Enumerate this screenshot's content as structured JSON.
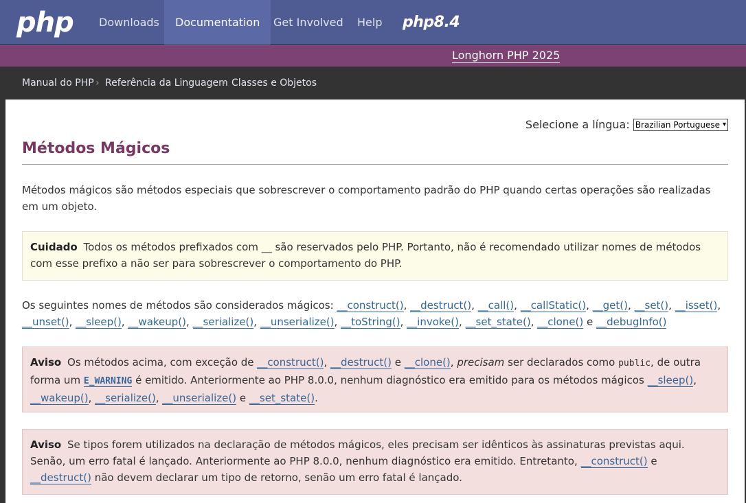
{
  "nav": {
    "logo": "php",
    "items": [
      "Downloads",
      "Documentation",
      "Get Involved",
      "Help"
    ],
    "release_badge": "php8.4"
  },
  "banner": {
    "link": "Longhorn PHP 2025"
  },
  "breadcrumb": [
    "Manual do PHP",
    "Referência da Linguagem",
    "Classes e Objetos"
  ],
  "language": {
    "label": "Selecione a língua:",
    "selected": "Brazilian Portuguese"
  },
  "page": {
    "title": "Métodos Mágicos",
    "intro": "Métodos mágicos são métodos especiais que sobrescrever o comportamento padrão do PHP quando certas operações são realizadas em um objeto.",
    "caution": {
      "label": "Cuidado",
      "text": "Todos os métodos prefixados com __ são reservados pelo PHP. Portanto, não é recomendado utilizar nomes de métodos com esse prefixo a não ser para sobrescrever o comportamento do PHP."
    },
    "methods_intro": "Os seguintes nomes de métodos são considerados mágicos:",
    "methods": [
      "__construct()",
      "__destruct()",
      "__call()",
      "__callStatic()",
      "__get()",
      "__set()",
      "__isset()",
      "__unset()",
      "__sleep()",
      "__wakeup()",
      "__serialize()",
      "__unserialize()",
      "__toString()",
      "__invoke()",
      "__set_state()",
      "__clone()",
      "__debugInfo()"
    ],
    "and_word": "e",
    "warning1": {
      "label": "Aviso",
      "t1": "Os métodos acima, com exceção de",
      "m1": "__construct()",
      "m2": "__destruct()",
      "e1": "e",
      "m3": "__clone()",
      "comma": ",",
      "em": "precisam",
      "t2": "ser declarados como",
      "code": "public",
      "t3": ", de outra forma um",
      "const": "E_WARNING",
      "t4": "é emitido. Anteriormente ao PHP 8.0.0, nenhum diagnóstico era emitido para os métodos mágicos",
      "m4": "__sleep()",
      "m5": "__wakeup()",
      "m6": "__serialize()",
      "m7": "__unserialize()",
      "e2": "e",
      "m8": "__set_state()",
      "end": "."
    },
    "warning2": {
      "label": "Aviso",
      "t1": "Se tipos forem utilizados na declaração de métodos mágicos, eles precisam ser idênticos às assinaturas previstas aqui. Senão, um erro fatal é lançado. Anteriormente ao PHP 8.0.0, nenhum diagnóstico era emitido. Entretanto,",
      "m1": "__construct()",
      "e1": "e",
      "m2": "__destruct()",
      "t2": "não devem declarar um tipo de retorno, senão um erro fatal é lançado."
    }
  }
}
